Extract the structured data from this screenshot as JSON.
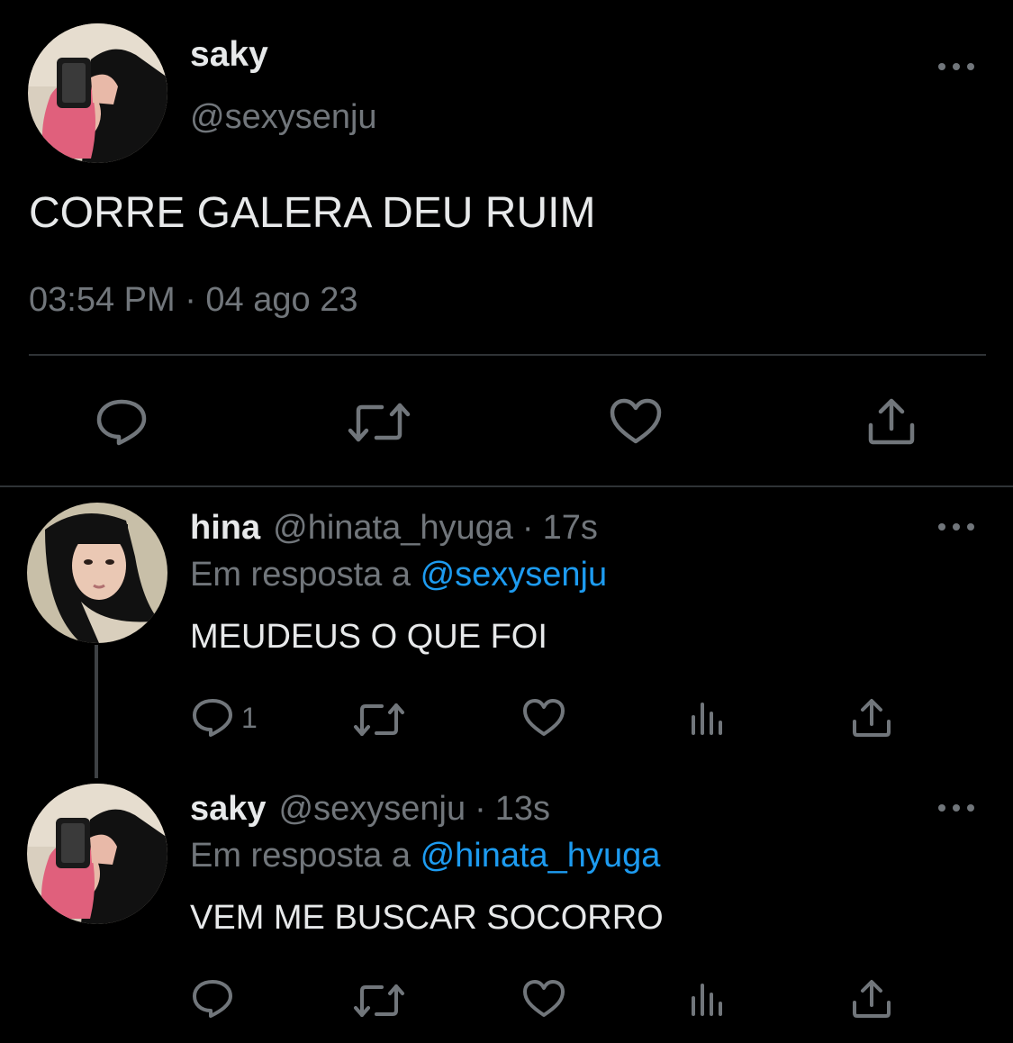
{
  "main_tweet": {
    "name": "saky",
    "handle": "@sexysenju",
    "text": "CORRE GALERA DEU RUIM",
    "timestamp": "03:54 PM · 04 ago 23",
    "actions": [
      "reply-icon",
      "retweet-icon",
      "like-icon",
      "share-icon"
    ]
  },
  "replies": [
    {
      "name": "hina",
      "handle": "@hinata_hyuga",
      "separator": "·",
      "time": "17s",
      "reply_prefix": "Em resposta a",
      "reply_to": "@sexysenju",
      "text": "MEUDEUS O QUE FOI",
      "reply_count": "1",
      "actions": [
        "reply-icon",
        "retweet-icon",
        "like-icon",
        "views-icon",
        "share-icon"
      ]
    },
    {
      "name": "saky",
      "handle": "@sexysenju",
      "separator": "·",
      "time": "13s",
      "reply_prefix": "Em resposta a",
      "reply_to": "@hinata_hyuga",
      "text": "VEM ME BUSCAR SOCORRO",
      "reply_count": "",
      "actions": [
        "reply-icon",
        "retweet-icon",
        "like-icon",
        "views-icon",
        "share-icon"
      ]
    }
  ],
  "colors": {
    "background": "#000000",
    "text_primary": "#e7e9ea",
    "text_secondary": "#71767b",
    "link": "#1d9bf0",
    "divider": "#2f3336"
  }
}
